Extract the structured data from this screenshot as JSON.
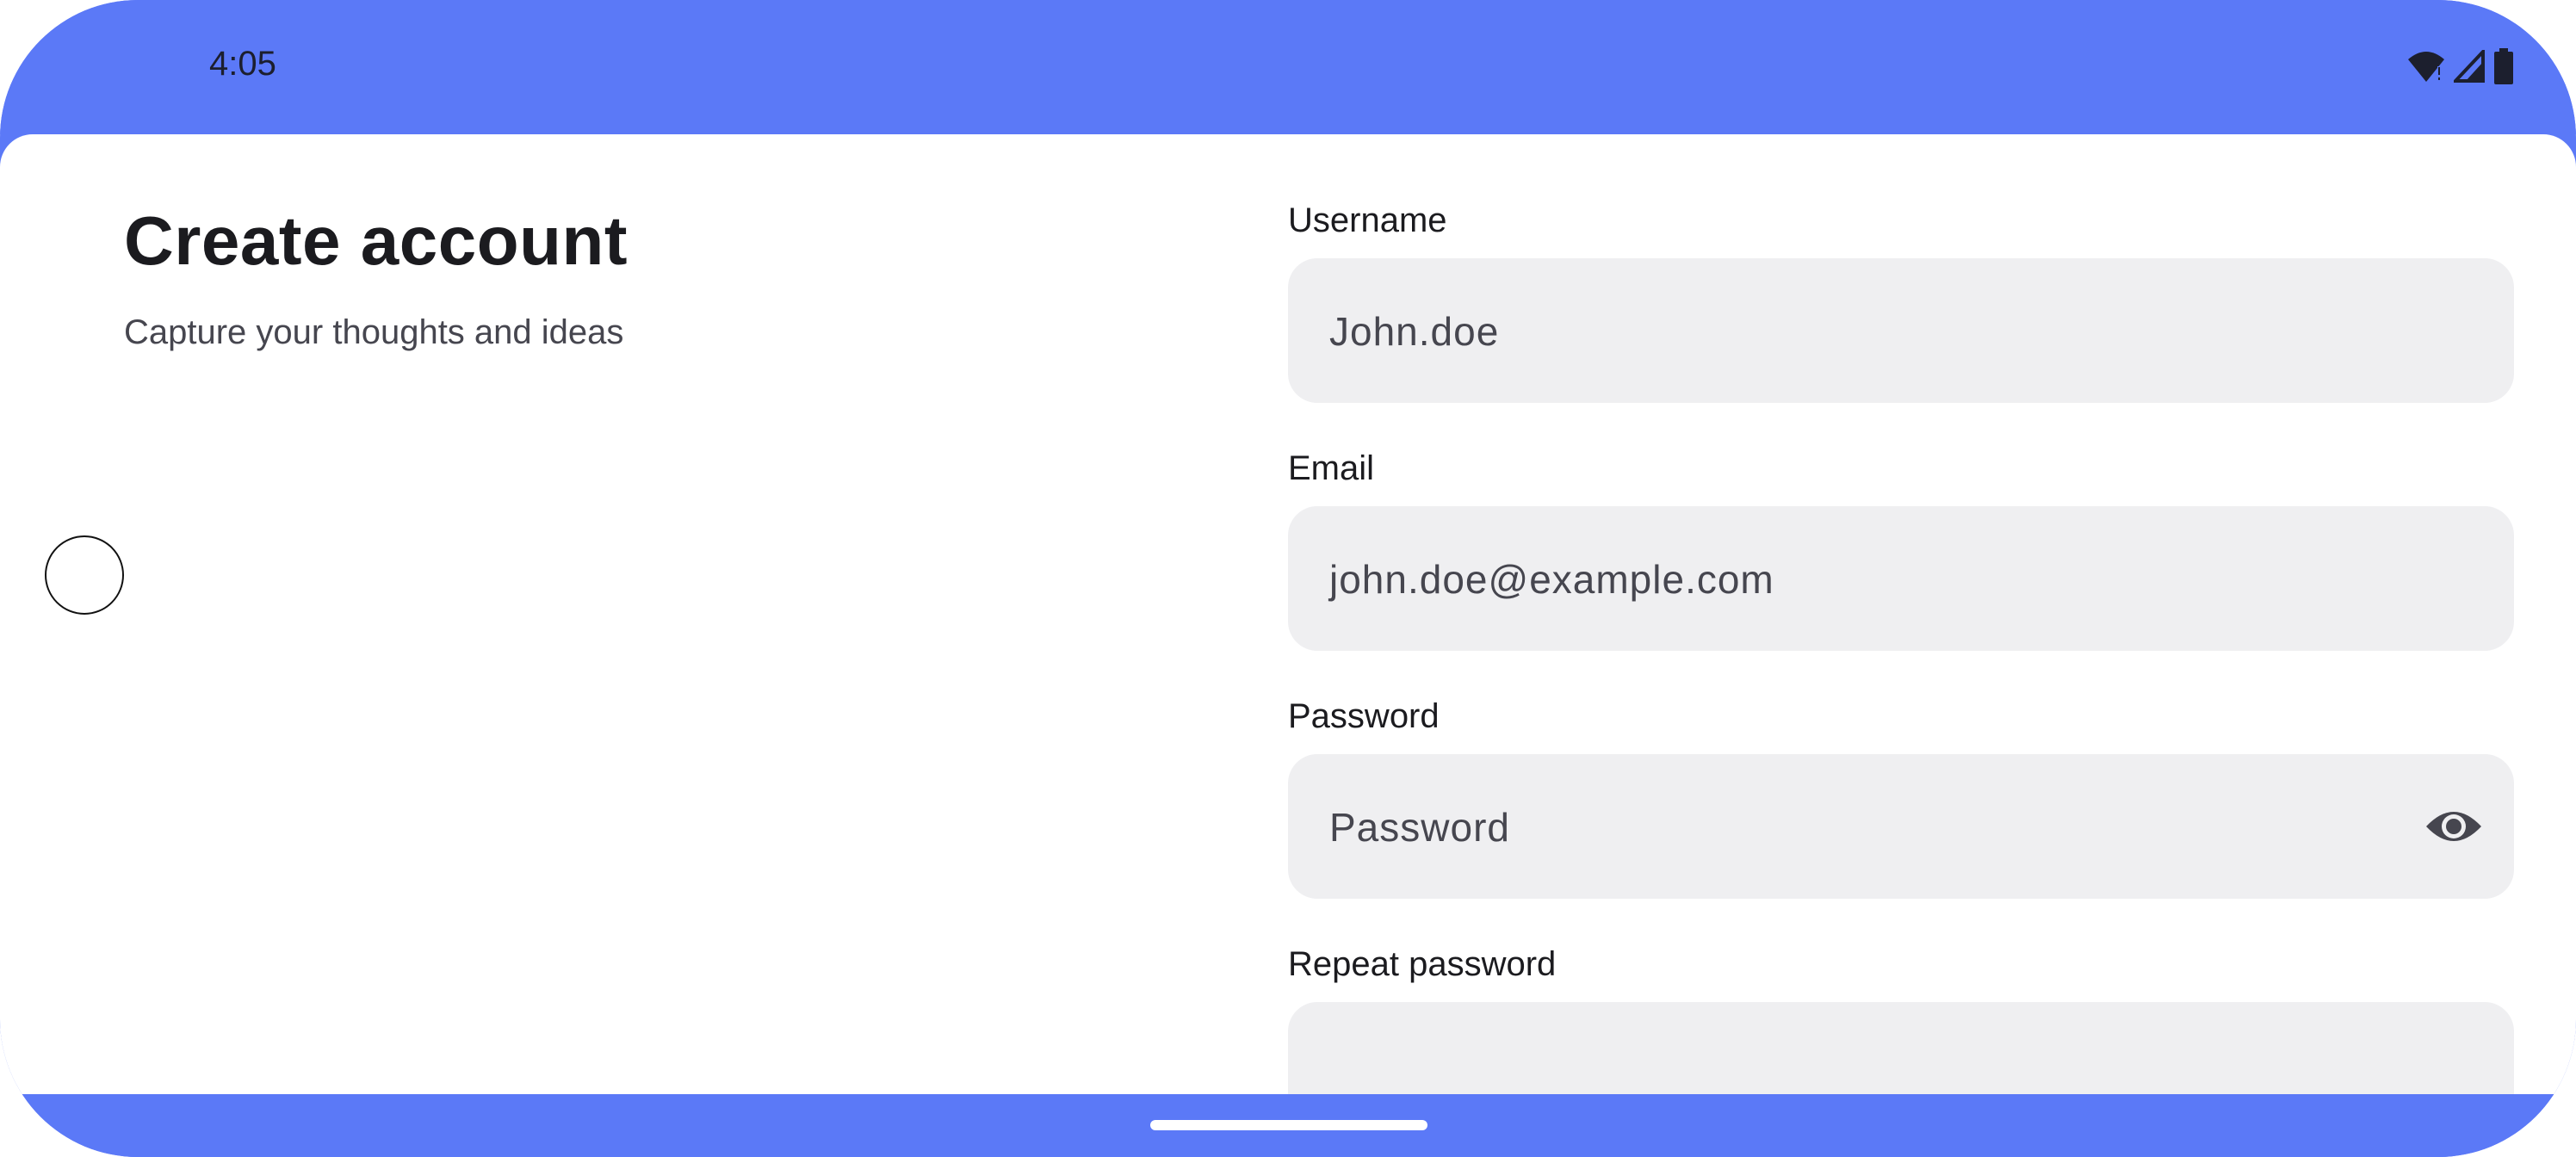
{
  "status_bar": {
    "time": "4:05",
    "icons": [
      "wifi-alert-icon",
      "signal-icon",
      "battery-icon"
    ]
  },
  "header": {
    "title": "Create account",
    "subtitle": "Capture your thoughts and ideas"
  },
  "form": {
    "username": {
      "label": "Username",
      "value": "John.doe"
    },
    "email": {
      "label": "Email",
      "value": "john.doe@example.com"
    },
    "password": {
      "label": "Password",
      "placeholder": "Password",
      "toggle_icon": "eye-icon"
    },
    "repeat_password": {
      "label": "Repeat password"
    }
  },
  "colors": {
    "system_bar": "#5b79f7",
    "field_background": "#efeff1",
    "title_text": "#1b1b1f",
    "secondary_text": "#46464f"
  }
}
